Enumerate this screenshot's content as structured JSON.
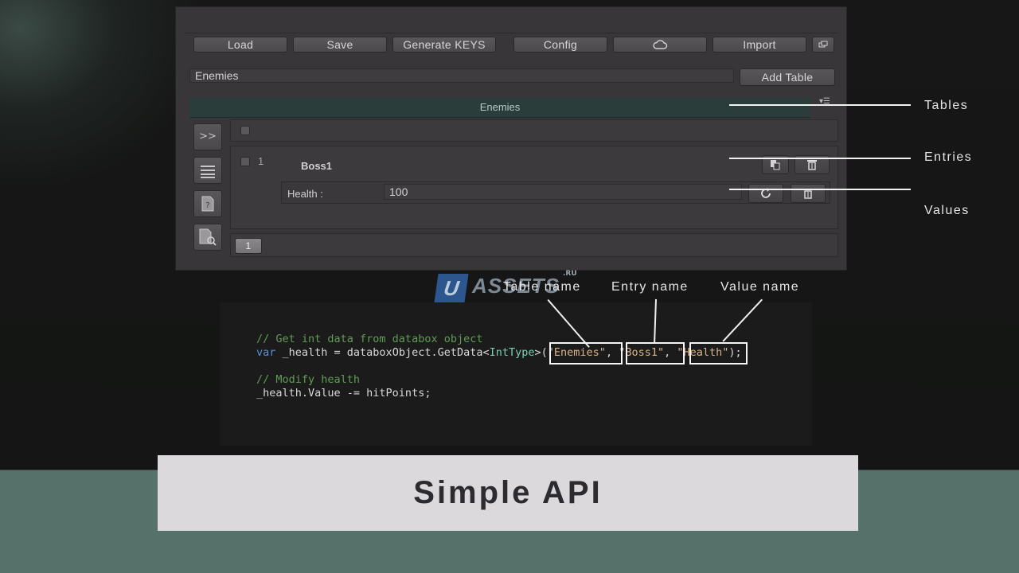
{
  "toolbar": {
    "load": "Load",
    "save": "Save",
    "generate_keys": "Generate KEYS",
    "config": "Config",
    "cloud_icon": "cloud-icon",
    "import": "Import",
    "window_icon": "window-icon"
  },
  "table_input": {
    "value": "Enemies"
  },
  "add_table_button": "Add Table",
  "active_table_tab": "Enemies",
  "sidebar": {
    "expand_label": ">>",
    "icons": [
      "list-icon",
      "help-document-icon",
      "search-document-icon"
    ]
  },
  "entry": {
    "index": "1",
    "name": "Boss1",
    "value_label": "Health :",
    "value": "100"
  },
  "pager": {
    "page": "1"
  },
  "callouts": {
    "tables": "Tables",
    "entries": "Entries",
    "values": "Values",
    "table_name": "Table name",
    "entry_name": "Entry name",
    "value_name": "Value name"
  },
  "watermark": {
    "u": "U",
    "text": "ASSETS",
    "suffix": ".RU"
  },
  "code": {
    "comment1": "// Get int data from databox object",
    "line1_kw": "var",
    "line1_a": " _health = databoxObject.GetData<",
    "line1_type": "IntType",
    "line1_b": ">(",
    "arg_table": "\"Enemies\"",
    "sep1": ", ",
    "arg_entry": "\"Boss1\"",
    "sep2": ", ",
    "arg_value": "\"Health\"",
    "line1_end": ");",
    "comment2": "// Modify health",
    "line2": "_health.Value -= hitPoints;"
  },
  "banner_title": "Simple API",
  "colors": {
    "accent_tab": "#2a3d3b",
    "code_comment": "#5f9c54",
    "code_keyword": "#5a8fd1",
    "code_type": "#7ccdb3",
    "logo_blue": "#2e5f9c"
  }
}
